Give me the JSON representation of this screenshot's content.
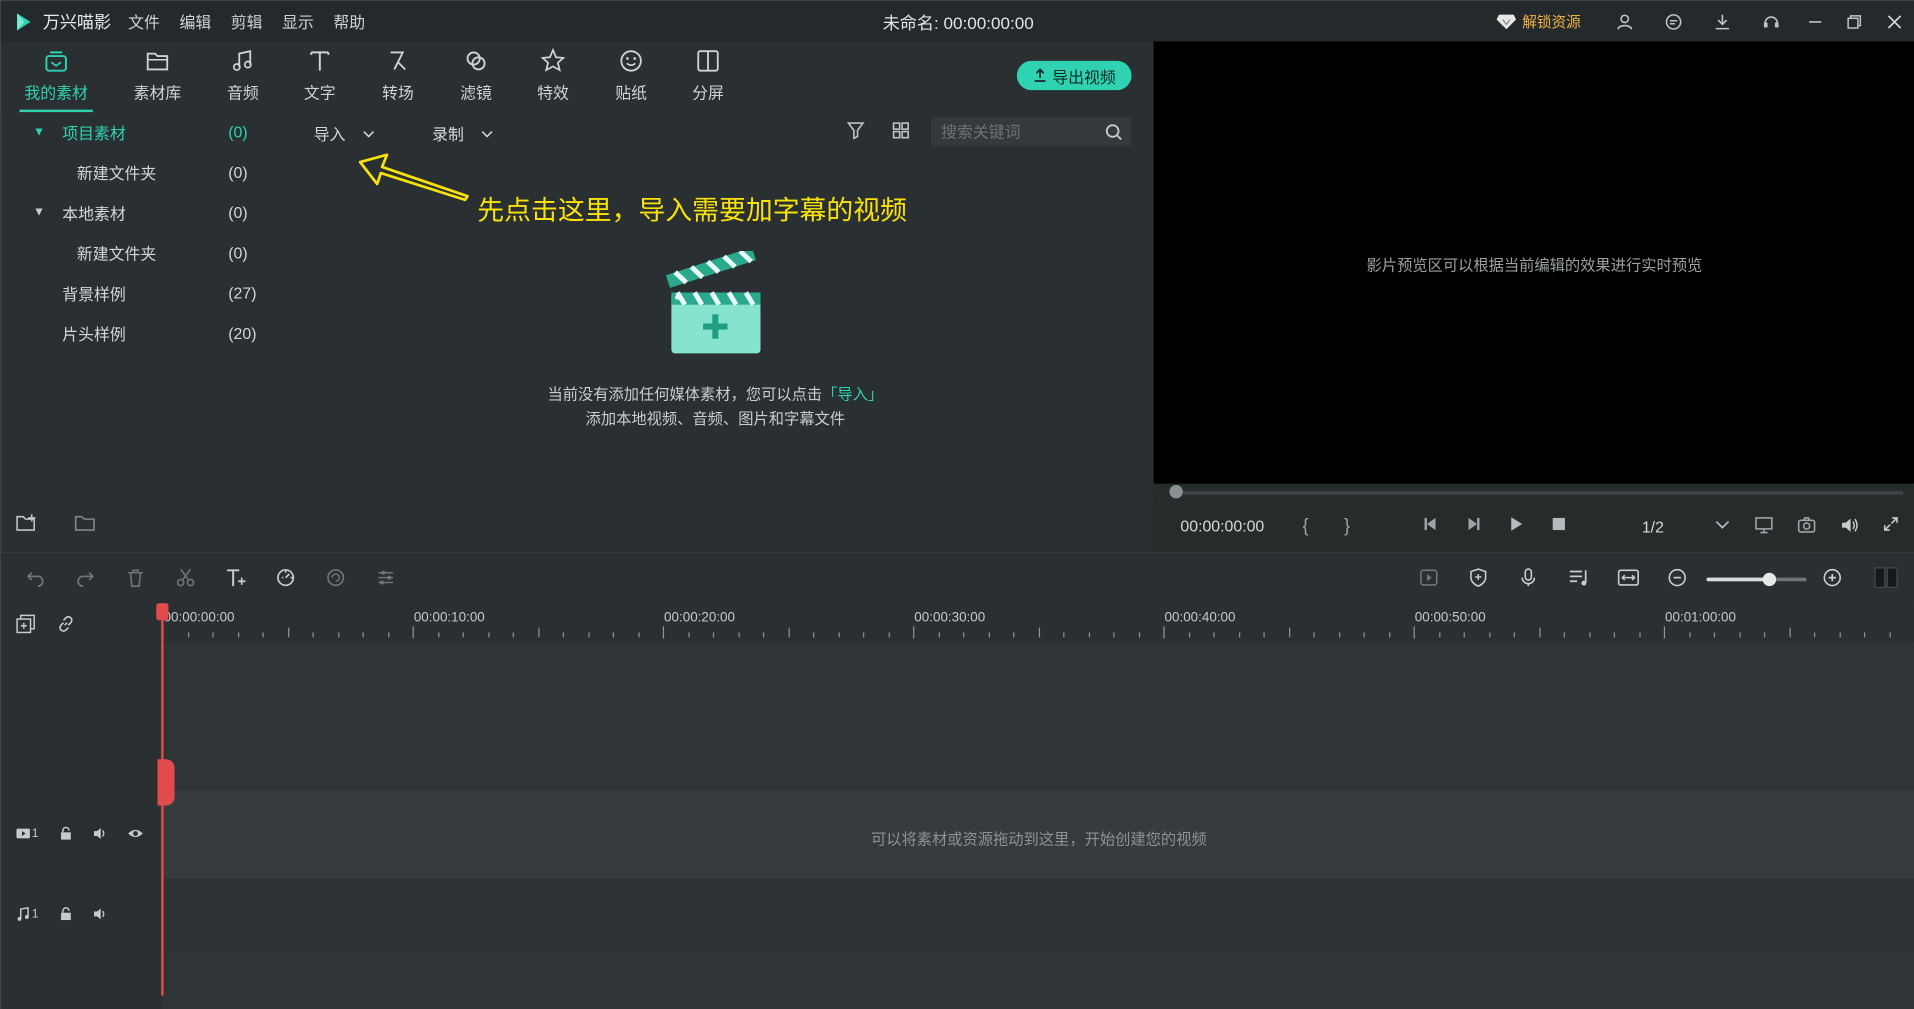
{
  "titlebar": {
    "app_name": "万兴喵影",
    "menus": [
      "文件",
      "编辑",
      "剪辑",
      "显示",
      "帮助"
    ],
    "project_title": "未命名: 00:00:00:00",
    "unlock_label": "解锁资源",
    "brand_color": "#2fd3b2"
  },
  "tools": [
    {
      "label": "我的素材",
      "icon": "my-media-icon"
    },
    {
      "label": "素材库",
      "icon": "folder-icon"
    },
    {
      "label": "音频",
      "icon": "music-note-icon"
    },
    {
      "label": "文字",
      "icon": "text-icon"
    },
    {
      "label": "转场",
      "icon": "transition-icon"
    },
    {
      "label": "滤镜",
      "icon": "filter-rings-icon"
    },
    {
      "label": "特效",
      "icon": "effects-star-icon"
    },
    {
      "label": "贴纸",
      "icon": "sticker-icon"
    },
    {
      "label": "分屏",
      "icon": "split-screen-icon"
    }
  ],
  "export_label": "导出视频",
  "tree": [
    {
      "name": "项目素材",
      "count": "(0)"
    },
    {
      "name": "新建文件夹",
      "count": "(0)"
    },
    {
      "name": "本地素材",
      "count": "(0)"
    },
    {
      "name": "新建文件夹",
      "count": "(0)"
    },
    {
      "name": "背景样例",
      "count": "(27)"
    },
    {
      "name": "片头样例",
      "count": "(20)"
    }
  ],
  "media": {
    "import_label": "导入",
    "record_label": "录制",
    "search_placeholder": "搜索关键词",
    "empty_line1_prefix": "当前没有添加任何媒体素材，您可以点击",
    "empty_line1_link": "「导入」",
    "empty_line2": "添加本地视频、音频、图片和字幕文件"
  },
  "annotation": "先点击这里，导入需要加字幕的视频",
  "preview": {
    "hint": "影片预览区可以根据当前编辑的效果进行实时预览",
    "timecode": "00:00:00:00",
    "ratio": "1/2"
  },
  "timeline": {
    "ticks": [
      "00:00:00:00",
      "00:00:10:00",
      "00:00:20:00",
      "00:00:30:00",
      "00:00:40:00",
      "00:00:50:00",
      "00:01:00:00"
    ],
    "drop_hint": "可以将素材或资源拖动到这里，开始创建您的视频",
    "video_track": "1",
    "audio_track": "1",
    "zoom_level": 0.62
  }
}
